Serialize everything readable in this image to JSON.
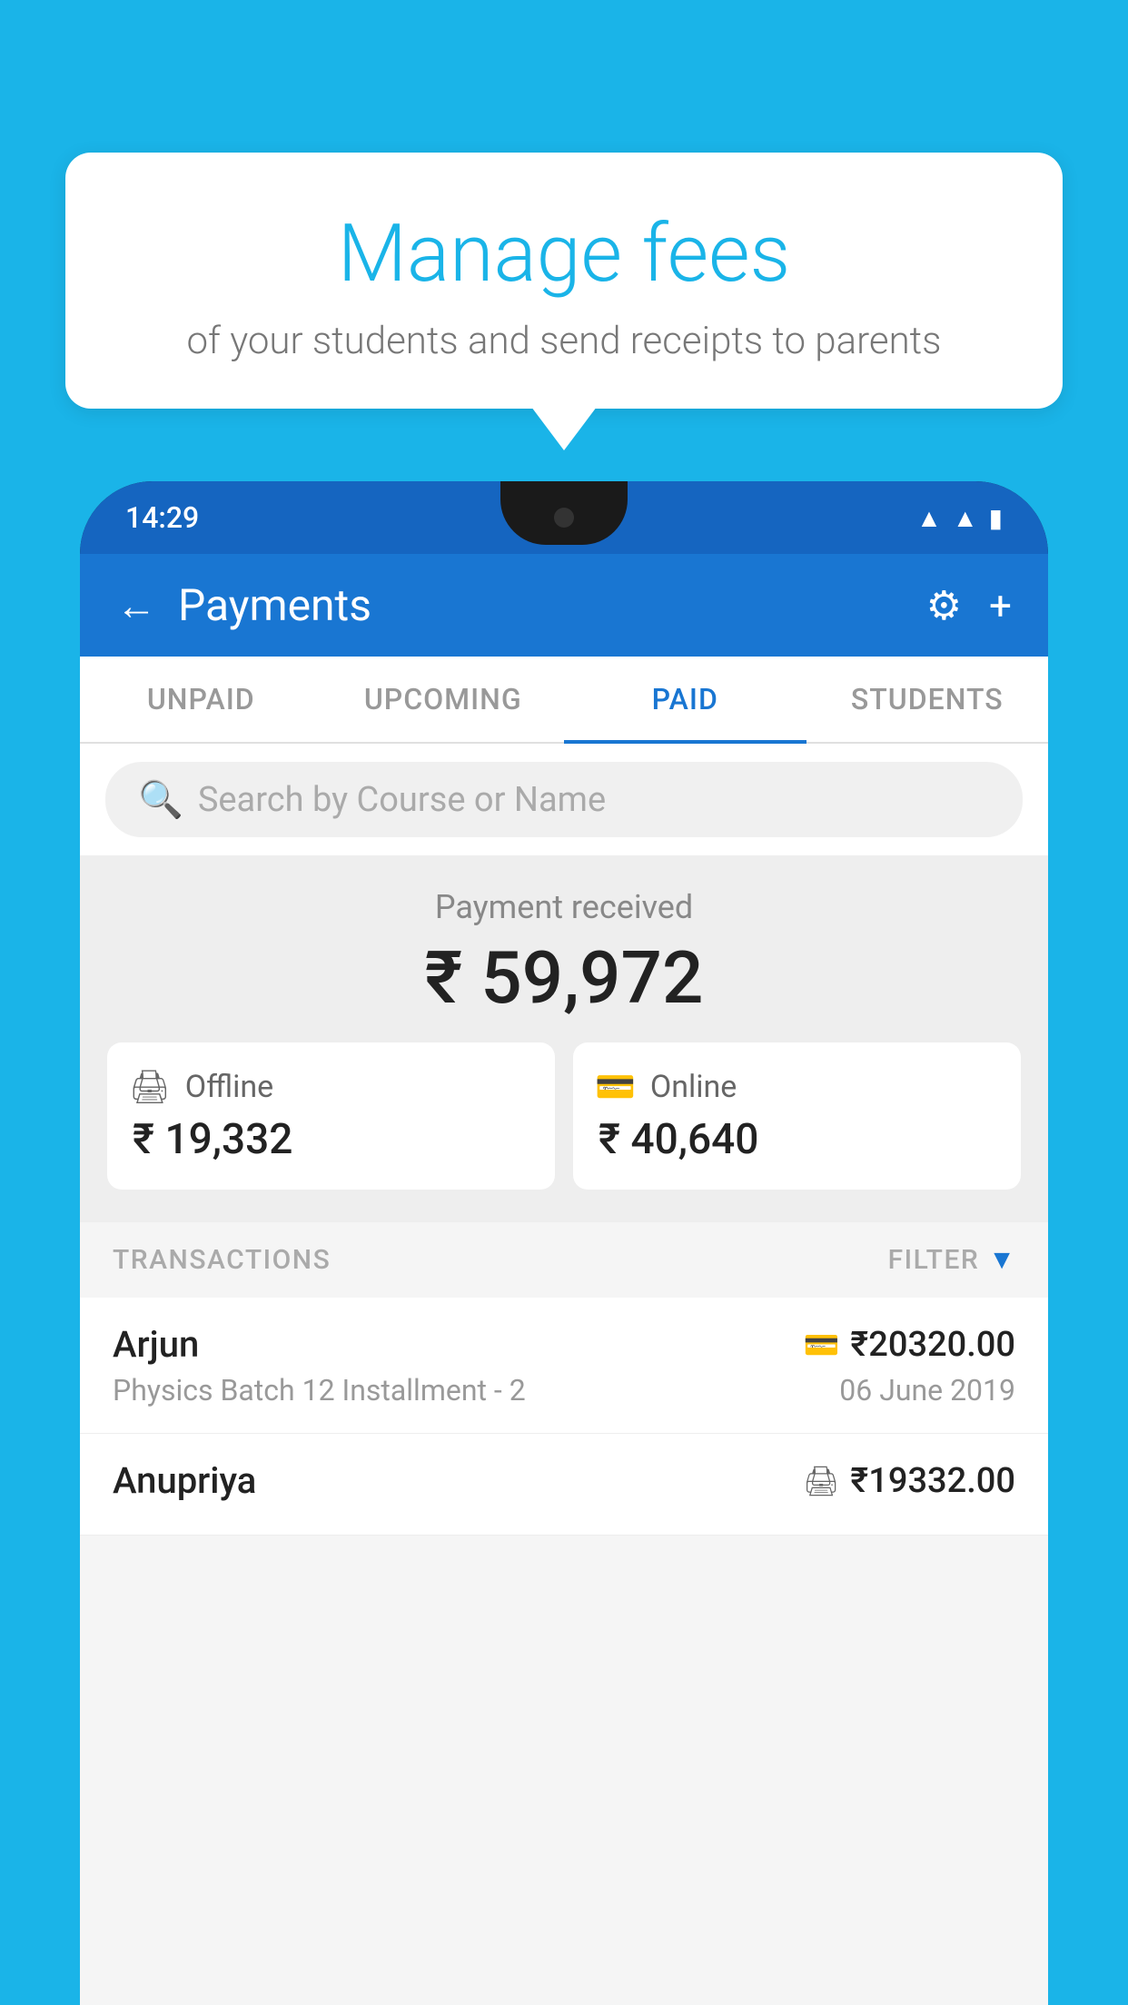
{
  "background_color": "#1ab4e8",
  "speech_bubble": {
    "title": "Manage fees",
    "subtitle": "of your students and send receipts to parents"
  },
  "phone": {
    "status_bar": {
      "time": "14:29",
      "icons": [
        "wifi",
        "signal",
        "battery"
      ]
    },
    "header": {
      "back_label": "←",
      "title": "Payments",
      "gear_icon": "⚙",
      "plus_icon": "+"
    },
    "tabs": [
      {
        "label": "UNPAID",
        "active": false
      },
      {
        "label": "UPCOMING",
        "active": false
      },
      {
        "label": "PAID",
        "active": true
      },
      {
        "label": "STUDENTS",
        "active": false
      }
    ],
    "search": {
      "placeholder": "Search by Course or Name"
    },
    "payment_summary": {
      "label": "Payment received",
      "total": "₹ 59,972",
      "offline": {
        "type": "Offline",
        "amount": "₹ 19,332"
      },
      "online": {
        "type": "Online",
        "amount": "₹ 40,640"
      }
    },
    "transactions": {
      "header_label": "TRANSACTIONS",
      "filter_label": "FILTER",
      "rows": [
        {
          "name": "Arjun",
          "amount": "₹20320.00",
          "description": "Physics Batch 12 Installment - 2",
          "date": "06 June 2019",
          "payment_type": "card"
        },
        {
          "name": "Anupriya",
          "amount": "₹19332.00",
          "description": "",
          "date": "",
          "payment_type": "cash"
        }
      ]
    }
  }
}
